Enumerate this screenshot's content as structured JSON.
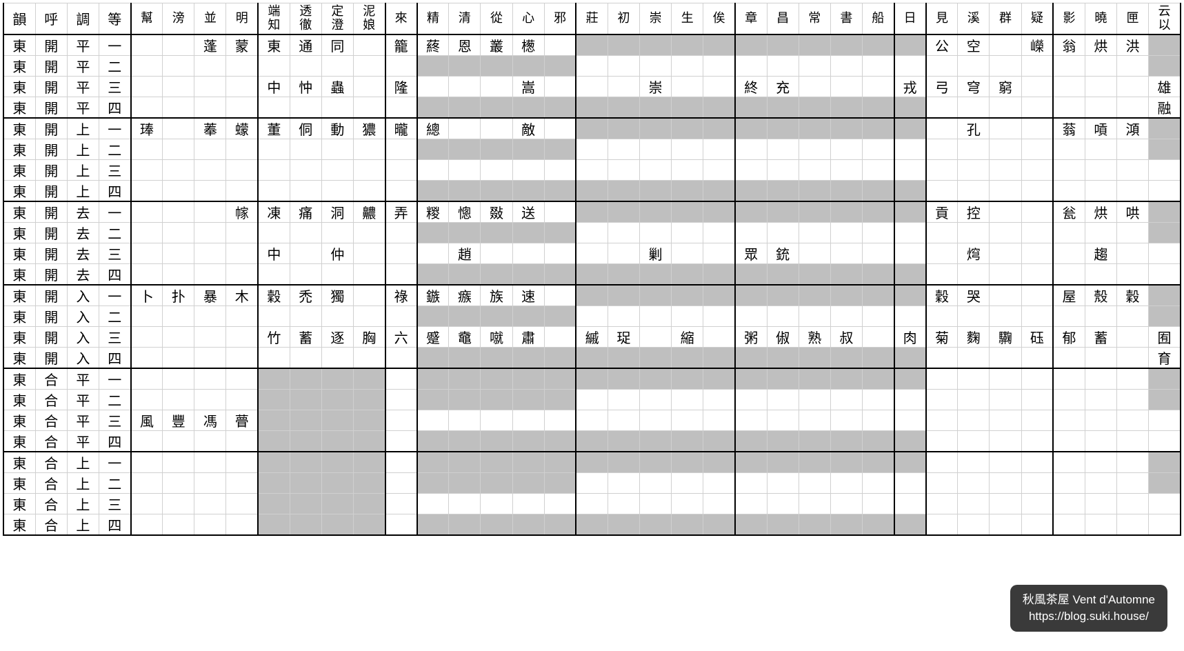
{
  "row_headers": [
    "韻",
    "呼",
    "調",
    "等"
  ],
  "initial_groups": [
    [
      "幫",
      "滂",
      "並",
      "明"
    ],
    [
      "端\n知",
      "透\n徹",
      "定\n澄",
      "泥\n娘"
    ],
    [
      "來"
    ],
    [
      "精",
      "清",
      "從",
      "心",
      "邪"
    ],
    [
      "莊",
      "初",
      "崇",
      "生",
      "俟"
    ],
    [
      "章",
      "昌",
      "常",
      "書",
      "船"
    ],
    [
      "日"
    ],
    [
      "見",
      "溪",
      "群",
      "疑"
    ],
    [
      "影",
      "曉",
      "匣",
      "云\n以"
    ]
  ],
  "deng": [
    "一",
    "二",
    "三",
    "四"
  ],
  "rows": [
    {
      "k": [
        "東",
        "開",
        "平",
        "一"
      ],
      "c": [
        "",
        "",
        "蓬",
        "蒙",
        "東",
        "通",
        "同",
        "",
        "籠",
        "蔠",
        "恩",
        "叢",
        "檧",
        "",
        "g",
        "g",
        "g",
        "g",
        "g",
        "g",
        "g",
        "g",
        "g",
        "g",
        "g",
        "公",
        "空",
        "",
        "嶸",
        "翁",
        "烘",
        "洪",
        "g"
      ]
    },
    {
      "k": [
        "東",
        "開",
        "平",
        "二"
      ],
      "c": [
        "",
        "",
        "",
        "",
        "",
        "",
        "",
        "",
        "",
        "g",
        "g",
        "g",
        "g",
        "g",
        "",
        "",
        "",
        "",
        "",
        "",
        "",
        "",
        "",
        "",
        "",
        "",
        "",
        "",
        "",
        "",
        "",
        "",
        "g"
      ]
    },
    {
      "k": [
        "東",
        "開",
        "平",
        "三"
      ],
      "c": [
        "",
        "",
        "",
        "",
        "中",
        "忡",
        "蟲",
        "",
        "隆",
        "",
        "",
        "",
        "嵩",
        "",
        "",
        "",
        "崇",
        "",
        "",
        "終",
        "充",
        "",
        "",
        "",
        "戎",
        "弓",
        "穹",
        "窮",
        "",
        "",
        "",
        "",
        "雄"
      ]
    },
    {
      "k": [
        "東",
        "開",
        "平",
        "四"
      ],
      "c": [
        "",
        "",
        "",
        "",
        "",
        "",
        "",
        "",
        "",
        "g",
        "g",
        "g",
        "g",
        "g",
        "g",
        "g",
        "g",
        "g",
        "g",
        "g",
        "g",
        "g",
        "g",
        "g",
        "g",
        "",
        "",
        "",
        "",
        "",
        "",
        "",
        "融"
      ]
    },
    {
      "k": [
        "東",
        "開",
        "上",
        "一"
      ],
      "c": [
        "琫",
        "",
        "菶",
        "蠓",
        "董",
        "侗",
        "動",
        "㺜",
        "曨",
        "總",
        "",
        "",
        "敵",
        "",
        "g",
        "g",
        "g",
        "g",
        "g",
        "g",
        "g",
        "g",
        "g",
        "g",
        "g",
        "",
        "孔",
        "",
        "",
        "蓊",
        "嗊",
        "澒",
        "g"
      ]
    },
    {
      "k": [
        "東",
        "開",
        "上",
        "二"
      ],
      "c": [
        "",
        "",
        "",
        "",
        "",
        "",
        "",
        "",
        "",
        "g",
        "g",
        "g",
        "g",
        "g",
        "",
        "",
        "",
        "",
        "",
        "",
        "",
        "",
        "",
        "",
        "",
        "",
        "",
        "",
        "",
        "",
        "",
        "",
        "g"
      ]
    },
    {
      "k": [
        "東",
        "開",
        "上",
        "三"
      ],
      "c": [
        "",
        "",
        "",
        "",
        "",
        "",
        "",
        "",
        "",
        "",
        "",
        "",
        "",
        "",
        "",
        "",
        "",
        "",
        "",
        "",
        "",
        "",
        "",
        "",
        "",
        "",
        "",
        "",
        "",
        "",
        "",
        "",
        ""
      ]
    },
    {
      "k": [
        "東",
        "開",
        "上",
        "四"
      ],
      "c": [
        "",
        "",
        "",
        "",
        "",
        "",
        "",
        "",
        "",
        "g",
        "g",
        "g",
        "g",
        "g",
        "g",
        "g",
        "g",
        "g",
        "g",
        "g",
        "g",
        "g",
        "g",
        "g",
        "g",
        "",
        "",
        "",
        "",
        "",
        "",
        "",
        ""
      ]
    },
    {
      "k": [
        "東",
        "開",
        "去",
        "一"
      ],
      "c": [
        "",
        "",
        "",
        "幏",
        "凍",
        "痛",
        "洞",
        "齈",
        "弄",
        "糉",
        "憁",
        "敠",
        "送",
        "",
        "g",
        "g",
        "g",
        "g",
        "g",
        "g",
        "g",
        "g",
        "g",
        "g",
        "g",
        "貢",
        "控",
        "",
        "",
        "瓮",
        "烘",
        "哄",
        "g"
      ]
    },
    {
      "k": [
        "東",
        "開",
        "去",
        "二"
      ],
      "c": [
        "",
        "",
        "",
        "",
        "",
        "",
        "",
        "",
        "",
        "g",
        "g",
        "g",
        "g",
        "g",
        "",
        "",
        "",
        "",
        "",
        "",
        "",
        "",
        "",
        "",
        "",
        "",
        "",
        "",
        "",
        "",
        "",
        "",
        "g"
      ]
    },
    {
      "k": [
        "東",
        "開",
        "去",
        "三"
      ],
      "c": [
        "",
        "",
        "",
        "",
        "中",
        "",
        "仲",
        "",
        "",
        "",
        "趙",
        "",
        "",
        "",
        "",
        "",
        "剿",
        "",
        "",
        "眾",
        "銃",
        "",
        "",
        "",
        "",
        "",
        "焪",
        "",
        "",
        "",
        "趨",
        "",
        ""
      ]
    },
    {
      "k": [
        "東",
        "開",
        "去",
        "四"
      ],
      "c": [
        "",
        "",
        "",
        "",
        "",
        "",
        "",
        "",
        "",
        "g",
        "g",
        "g",
        "g",
        "g",
        "g",
        "g",
        "g",
        "g",
        "g",
        "g",
        "g",
        "g",
        "g",
        "g",
        "g",
        "",
        "",
        "",
        "",
        "",
        "",
        "",
        ""
      ]
    },
    {
      "k": [
        "東",
        "開",
        "入",
        "一"
      ],
      "c": [
        "卜",
        "扑",
        "暴",
        "木",
        "穀",
        "禿",
        "獨",
        "",
        "祿",
        "鏃",
        "瘯",
        "族",
        "速",
        "",
        "g",
        "g",
        "g",
        "g",
        "g",
        "g",
        "g",
        "g",
        "g",
        "g",
        "g",
        "穀",
        "哭",
        "",
        "",
        "屋",
        "殼",
        "穀",
        "g"
      ]
    },
    {
      "k": [
        "東",
        "開",
        "入",
        "二"
      ],
      "c": [
        "",
        "",
        "",
        "",
        "",
        "",
        "",
        "",
        "",
        "g",
        "g",
        "g",
        "g",
        "g",
        "",
        "",
        "",
        "",
        "",
        "",
        "",
        "",
        "",
        "",
        "",
        "",
        "",
        "",
        "",
        "",
        "",
        "",
        "g"
      ]
    },
    {
      "k": [
        "東",
        "開",
        "入",
        "三"
      ],
      "c": [
        "",
        "",
        "",
        "",
        "竹",
        "蓄",
        "逐",
        "胸",
        "六",
        "蹙",
        "鼀",
        "噈",
        "肅",
        "",
        "縬",
        "珿",
        "",
        "縮",
        "",
        "粥",
        "俶",
        "熟",
        "叔",
        "",
        "肉",
        "菊",
        "麴",
        "驧",
        "砡",
        "郁",
        "蓄",
        "",
        "囿"
      ]
    },
    {
      "k": [
        "東",
        "開",
        "入",
        "四"
      ],
      "c": [
        "",
        "",
        "",
        "",
        "",
        "",
        "",
        "",
        "",
        "g",
        "g",
        "g",
        "g",
        "g",
        "g",
        "g",
        "g",
        "g",
        "g",
        "g",
        "g",
        "g",
        "g",
        "g",
        "g",
        "",
        "",
        "",
        "",
        "",
        "",
        "",
        "育"
      ]
    },
    {
      "k": [
        "東",
        "合",
        "平",
        "一"
      ],
      "c": [
        "",
        "",
        "",
        "",
        "g",
        "g",
        "g",
        "g",
        "",
        "g",
        "g",
        "g",
        "g",
        "g",
        "g",
        "g",
        "g",
        "g",
        "g",
        "g",
        "g",
        "g",
        "g",
        "g",
        "g",
        "",
        "",
        "",
        "",
        "",
        "",
        "",
        "g"
      ]
    },
    {
      "k": [
        "東",
        "合",
        "平",
        "二"
      ],
      "c": [
        "",
        "",
        "",
        "",
        "g",
        "g",
        "g",
        "g",
        "",
        "g",
        "g",
        "g",
        "g",
        "g",
        "",
        "",
        "",
        "",
        "",
        "",
        "",
        "",
        "",
        "",
        "",
        "",
        "",
        "",
        "",
        "",
        "",
        "",
        "g"
      ]
    },
    {
      "k": [
        "東",
        "合",
        "平",
        "三"
      ],
      "c": [
        "風",
        "豐",
        "馮",
        "瞢",
        "g",
        "g",
        "g",
        "g",
        "",
        "",
        "",
        "",
        "",
        "",
        "",
        "",
        "",
        "",
        "",
        "",
        "",
        "",
        "",
        "",
        "",
        "",
        "",
        "",
        "",
        "",
        "",
        "",
        ""
      ]
    },
    {
      "k": [
        "東",
        "合",
        "平",
        "四"
      ],
      "c": [
        "",
        "",
        "",
        "",
        "g",
        "g",
        "g",
        "g",
        "",
        "g",
        "g",
        "g",
        "g",
        "g",
        "g",
        "g",
        "g",
        "g",
        "g",
        "g",
        "g",
        "g",
        "g",
        "g",
        "g",
        "",
        "",
        "",
        "",
        "",
        "",
        "",
        ""
      ]
    },
    {
      "k": [
        "東",
        "合",
        "上",
        "一"
      ],
      "c": [
        "",
        "",
        "",
        "",
        "g",
        "g",
        "g",
        "g",
        "",
        "g",
        "g",
        "g",
        "g",
        "g",
        "g",
        "g",
        "g",
        "g",
        "g",
        "g",
        "g",
        "g",
        "g",
        "g",
        "g",
        "",
        "",
        "",
        "",
        "",
        "",
        "",
        "g"
      ]
    },
    {
      "k": [
        "東",
        "合",
        "上",
        "二"
      ],
      "c": [
        "",
        "",
        "",
        "",
        "g",
        "g",
        "g",
        "g",
        "",
        "g",
        "g",
        "g",
        "g",
        "g",
        "",
        "",
        "",
        "",
        "",
        "",
        "",
        "",
        "",
        "",
        "",
        "",
        "",
        "",
        "",
        "",
        "",
        "",
        "g"
      ]
    },
    {
      "k": [
        "東",
        "合",
        "上",
        "三"
      ],
      "c": [
        "",
        "",
        "",
        "",
        "g",
        "g",
        "g",
        "g",
        "",
        "",
        "",
        "",
        "",
        "",
        "",
        "",
        "",
        "",
        "",
        "",
        "",
        "",
        "",
        "",
        "",
        "",
        "",
        "",
        "",
        "",
        "",
        "",
        ""
      ]
    },
    {
      "k": [
        "東",
        "合",
        "上",
        "四"
      ],
      "c": [
        "",
        "",
        "",
        "",
        "g",
        "g",
        "g",
        "g",
        "",
        "g",
        "g",
        "g",
        "g",
        "g",
        "g",
        "g",
        "g",
        "g",
        "g",
        "g",
        "g",
        "g",
        "g",
        "g",
        "g",
        "",
        "",
        "",
        "",
        "",
        "",
        "",
        ""
      ]
    }
  ],
  "watermark": {
    "line1": "秋風茶屋 Vent d'Automne",
    "line2": "https://blog.suki.house/"
  }
}
